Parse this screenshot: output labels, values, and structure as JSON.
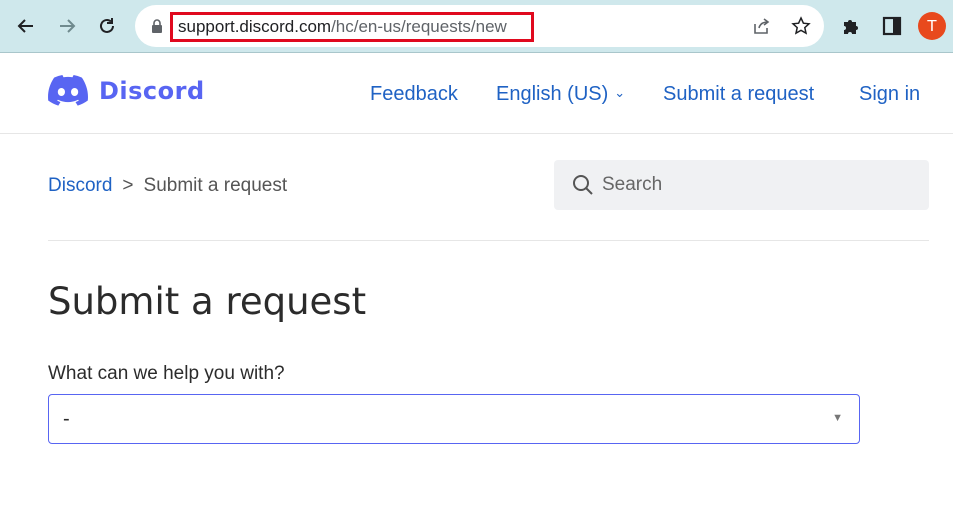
{
  "browser": {
    "url_host": "support.discord.com",
    "url_path": "/hc/en-us/requests/new",
    "profile_initial": "T"
  },
  "header": {
    "logo_text": "Discord",
    "nav": {
      "feedback": "Feedback",
      "language": "English (US)",
      "submit_request": "Submit a request",
      "sign_in": "Sign in"
    }
  },
  "breadcrumb": {
    "home": "Discord",
    "separator": ">",
    "current": "Submit a request"
  },
  "search": {
    "placeholder": "Search"
  },
  "main": {
    "title": "Submit a request",
    "field_label": "What can we help you with?",
    "select_value": "-"
  },
  "colors": {
    "brand": "#5865f2",
    "link": "#1f62c4",
    "url_highlight": "#e0091e",
    "toolbar_bg": "#cfe8ec"
  }
}
